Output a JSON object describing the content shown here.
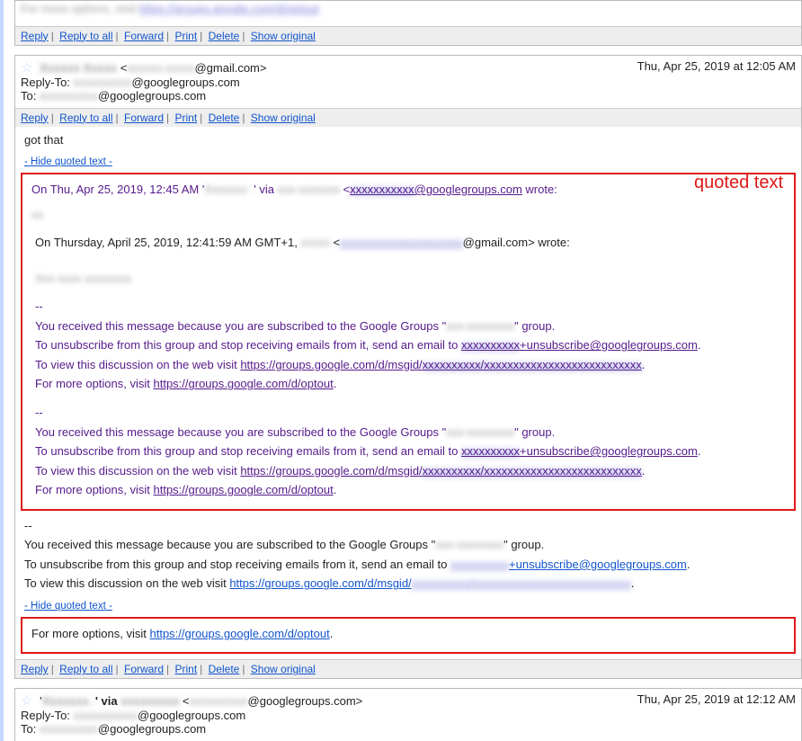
{
  "actions": {
    "reply": "Reply",
    "reply_all": "Reply to all",
    "forward": "Forward",
    "print": "Print",
    "delete": "Delete",
    "show_original": "Show original"
  },
  "hide_quoted": "- Hide quoted text -",
  "annotation": "quoted text",
  "partial_top": {
    "more_options_prefix": "For more options, visit ",
    "optout_link": "https://groups.google.com/d/optout"
  },
  "msg1": {
    "from_name_blur": "Xxxxxx Xxxxx",
    "from_addr_blur": "xxxxxx.xxxxx",
    "from_domain": "@gmail.com>",
    "date": "Thu, Apr 25, 2019 at 12:05 AM",
    "reply_to_label": "Reply-To: ",
    "reply_to_blur": "xxxxxxxxxx",
    "reply_to_domain": "@googlegroups.com",
    "to_label": "To: ",
    "to_blur": "xxxxxxxxxx",
    "to_domain": "@googlegroups.com",
    "body_line": "got that",
    "quoted_intro_prefix": "On Thu, Apr 25, 2019, 12:45 AM '",
    "quoted_intro_name_blur": "Xxxxxxx .",
    "quoted_intro_mid": "' via ",
    "quoted_intro_group_blur": "xxx-xxxxxxx",
    "quoted_intro_angle": " <",
    "quoted_intro_email_blur": "xxxxxxxxxxx",
    "quoted_intro_email_domain": "@googlegroups.com",
    "quoted_intro_end": " wrote:",
    "inner_line_prefix": "On Thursday, April 25, 2019, 12:41:59 AM GMT+1, ",
    "inner_name_blur": "xxxxx",
    "inner_angle": " <",
    "inner_email_blur": "xxxxxxxxxxxxxxxxxxxxx",
    "inner_email_domain": "@gmail.com",
    "inner_end": "> wrote:",
    "blur_body": "Xxx xxxx xxxxxxxx",
    "dashdash": "--",
    "grp_line_a": "You received this message because you are subscribed to the Google Groups \"",
    "grp_blur": "xxx-xxxxxxxx",
    "grp_line_b": "\" group.",
    "unsub_a": "To unsubscribe from this group and stop receiving emails from it, send an email to ",
    "unsub_blur": "xxxxxxxxxx",
    "unsub_sfx": "+unsubscribe@googlegroups.com",
    "unsub_dot": ".",
    "view_a": "To view this discussion on the web visit ",
    "msgid_link": "https://groups.google.com/d/msgid/",
    "msgid_blur": "xxxxxxxxxx/xxxxxxxxxxxxxxxxxxxxxxxxxxx",
    "more_prefix": "For more options, visit ",
    "optout": "https://groups.google.com/d/optout",
    "dot": "."
  },
  "msg2": {
    "from_prefix": "'",
    "from_name_blur": "Xxxxxxx .",
    "from_mid": "' via ",
    "from_group_blur": "xxxxxxxxx",
    "from_angle": " <",
    "from_email_blur": "xxxxxxxxxx",
    "from_domain": "@googlegroups.com>",
    "date": "Thu, Apr 25, 2019 at 12:12 AM",
    "reply_to_label": "Reply-To: ",
    "reply_to_blur": "xxxxxxxxxxx",
    "reply_to_domain": "@googlegroups.com",
    "to_label": "To: ",
    "to_blur": "xxxxxxxxxx",
    "to_domain": "@googlegroups.com"
  }
}
